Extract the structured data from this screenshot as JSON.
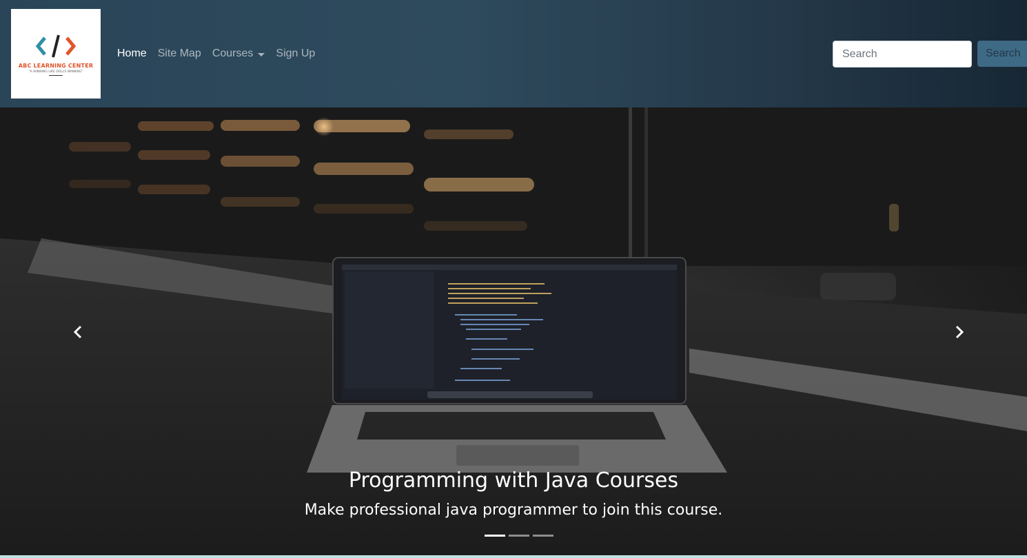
{
  "brand": {
    "logo_title": "ABC LEARNING CENTER",
    "logo_tagline": "\"A WINNING LIKE DOLLS WINNING\""
  },
  "nav": {
    "items": [
      {
        "label": "Home",
        "active": true
      },
      {
        "label": "Site Map"
      },
      {
        "label": "Courses",
        "dropdown": true
      },
      {
        "label": "Sign Up"
      }
    ]
  },
  "search": {
    "placeholder": "Search",
    "button_label": "Search"
  },
  "carousel": {
    "title": "Programming with Java Courses",
    "subtitle": "Make professional java programmer to join this course.",
    "slide_count": 3,
    "active_slide": 1
  },
  "colors": {
    "navbar": "#2e4a5d",
    "logo_orange": "#e0552b",
    "logo_teal": "#2f8fa6",
    "search_button": "#3f6a85"
  }
}
